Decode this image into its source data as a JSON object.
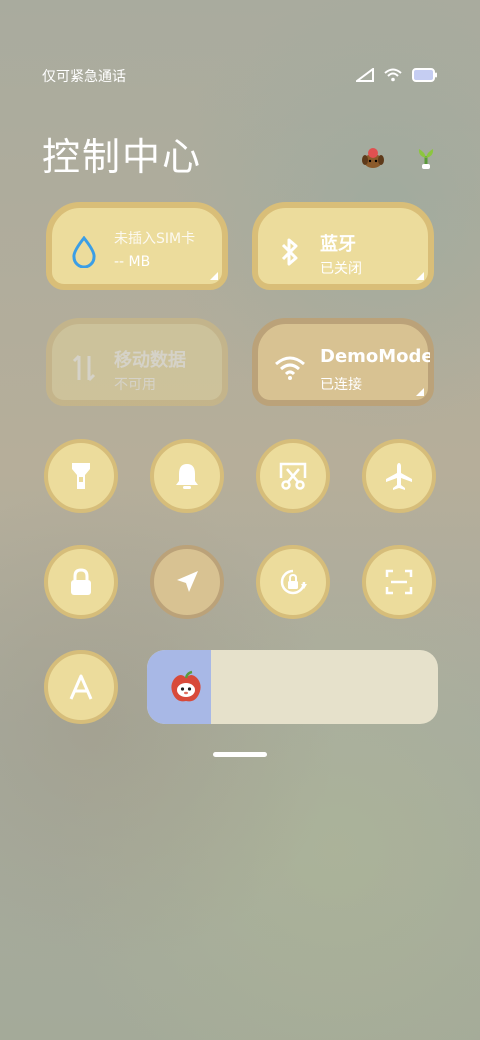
{
  "status_bar": {
    "carrier": "仅可紧急通话",
    "icons": [
      "cell-signal-icon",
      "wifi-icon",
      "battery-icon"
    ]
  },
  "header": {
    "title": "控制中心",
    "icons": [
      "dog-icon",
      "plant-icon"
    ]
  },
  "tiles": [
    {
      "main": "未插入SIM卡",
      "sub": "-- MB",
      "icon": "water-drop-icon",
      "state": "normal"
    },
    {
      "main": "蓝牙",
      "sub": "已关闭",
      "icon": "bluetooth-icon",
      "state": "normal"
    },
    {
      "main": "移动数据",
      "sub": "不可用",
      "icon": "data-arrows-icon",
      "state": "disabled"
    },
    {
      "main": "DemoMode",
      "sub": "已连接",
      "icon": "wifi-icon",
      "state": "active"
    }
  ],
  "toggles": [
    {
      "icon": "flashlight-icon",
      "active": false
    },
    {
      "icon": "bell-icon",
      "active": false
    },
    {
      "icon": "screenshot-icon",
      "active": false
    },
    {
      "icon": "airplane-icon",
      "active": false
    },
    {
      "icon": "lock-icon",
      "active": false
    },
    {
      "icon": "location-icon",
      "active": true
    },
    {
      "icon": "auto-rotate-icon",
      "active": false
    },
    {
      "icon": "scan-icon",
      "active": false
    },
    {
      "icon": "font-icon",
      "active": false
    }
  ],
  "brightness": {
    "level": 0.22,
    "thumb_icon": "apple-face-icon",
    "colors": {
      "fill": "#a8b8e6",
      "track": "#e6e1cb"
    }
  },
  "colors": {
    "tile": "#ecdc9c",
    "tile_border": "#d9be78",
    "active_tile": "#d8c292"
  }
}
